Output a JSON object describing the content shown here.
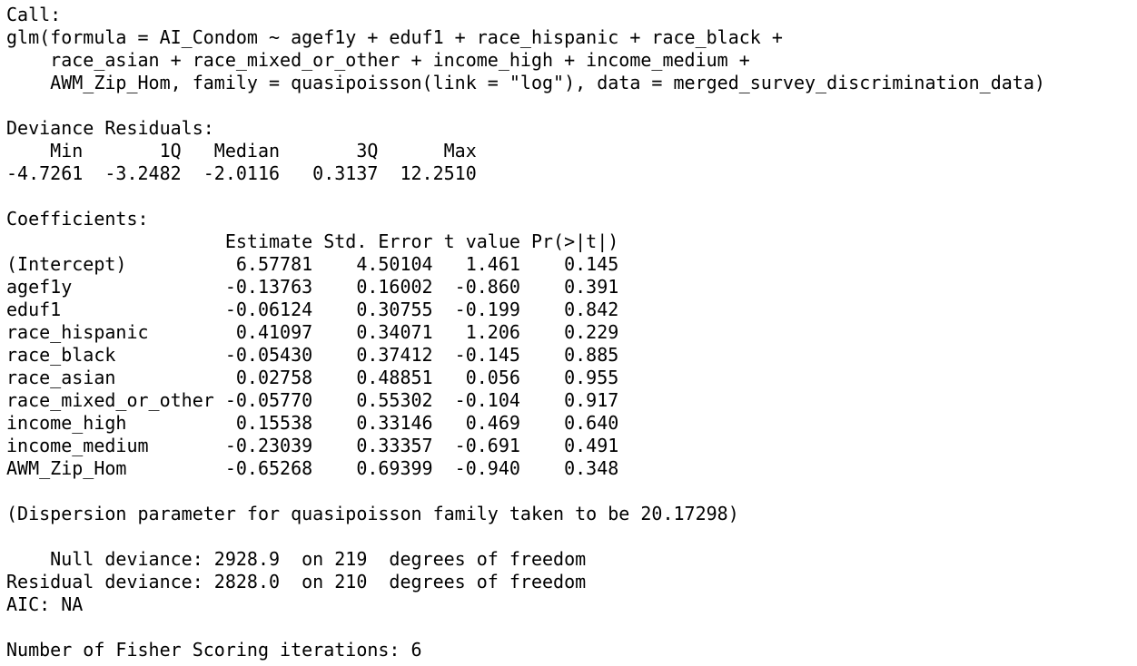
{
  "console": {
    "lines": [
      "Call:",
      "glm(formula = AI_Condom ~ agef1y + eduf1 + race_hispanic + race_black + ",
      "    race_asian + race_mixed_or_other + income_high + income_medium + ",
      "    AWM_Zip_Hom, family = quasipoisson(link = \"log\"), data = merged_survey_discrimination_data)",
      "",
      "Deviance Residuals: ",
      "    Min       1Q   Median       3Q      Max  ",
      "-4.7261  -3.2482  -2.0116   0.3137  12.2510  ",
      "",
      "Coefficients:",
      "                    Estimate Std. Error t value Pr(>|t|)",
      "(Intercept)          6.57781    4.50104   1.461    0.145",
      "agef1y              -0.13763    0.16002  -0.860    0.391",
      "eduf1               -0.06124    0.30755  -0.199    0.842",
      "race_hispanic        0.41097    0.34071   1.206    0.229",
      "race_black          -0.05430    0.37412  -0.145    0.885",
      "race_asian           0.02758    0.48851   0.056    0.955",
      "race_mixed_or_other -0.05770    0.55302  -0.104    0.917",
      "income_high          0.15538    0.33146   0.469    0.640",
      "income_medium       -0.23039    0.33357  -0.691    0.491",
      "AWM_Zip_Hom         -0.65268    0.69399  -0.940    0.348",
      "",
      "(Dispersion parameter for quasipoisson family taken to be 20.17298)",
      "",
      "    Null deviance: 2928.9  on 219  degrees of freedom",
      "Residual deviance: 2828.0  on 210  degrees of freedom",
      "AIC: NA",
      "",
      "Number of Fisher Scoring iterations: 6"
    ]
  }
}
